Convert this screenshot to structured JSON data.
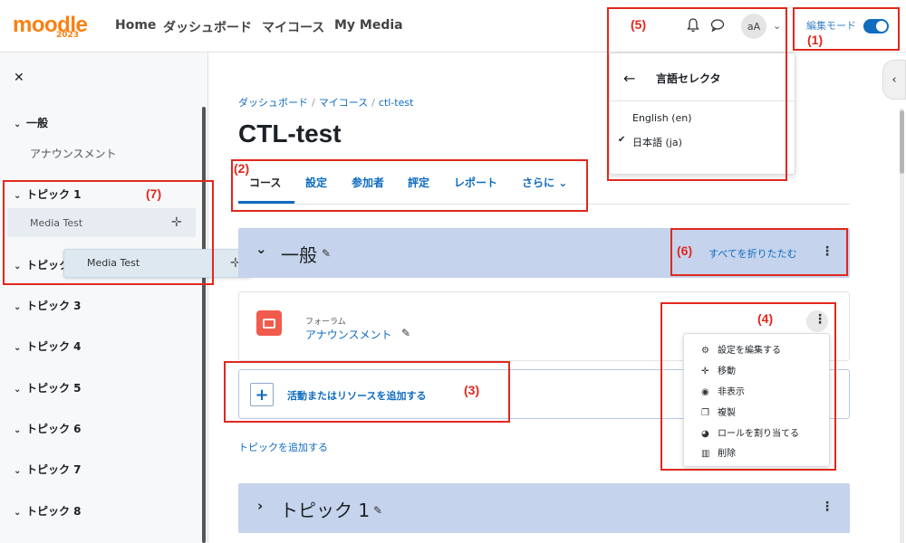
{
  "header": {
    "logo_text": "moodle",
    "logo_year": "2023",
    "nav": [
      "Home",
      "ダッシュボード",
      "マイコース",
      "My Media"
    ],
    "avatar_initials": "aA",
    "edit_mode_label": "編集モード",
    "edit_mode_on": true
  },
  "language_menu": {
    "title": "言語セレクタ",
    "options": [
      "English (en)",
      "日本語 (ja)"
    ],
    "selected": "日本語 (ja)"
  },
  "drawer": {
    "sections": [
      {
        "label": "一般",
        "items": [
          "アナウンスメント"
        ]
      },
      {
        "label": "トピック 1",
        "items": [
          "Media Test"
        ]
      },
      {
        "label": "トピック 2",
        "items": []
      },
      {
        "label": "トピック 3",
        "items": []
      },
      {
        "label": "トピック 4",
        "items": []
      },
      {
        "label": "トピック 5",
        "items": []
      },
      {
        "label": "トピック 6",
        "items": []
      },
      {
        "label": "トピック 7",
        "items": []
      },
      {
        "label": "トピック 8",
        "items": []
      }
    ],
    "dragging_item": "Media Test"
  },
  "breadcrumb": [
    "ダッシュボード",
    "マイコース",
    "ctl-test"
  ],
  "page_title": "CTL-test",
  "tabs": [
    "コース",
    "設定",
    "参加者",
    "評定",
    "レポート",
    "さらに"
  ],
  "active_tab": "コース",
  "sections": [
    {
      "title": "一般",
      "collapse_all": "すべてを折りたたむ"
    },
    {
      "title": "トピック 1"
    }
  ],
  "activity": {
    "type": "フォーラム",
    "name": "アナウンスメント"
  },
  "add_activity_label": "活動またはリソースを追加する",
  "add_topic_label": "トピックを追加する",
  "action_menu": [
    {
      "icon": "gear-icon",
      "label": "設定を編集する"
    },
    {
      "icon": "move-icon",
      "label": "移動"
    },
    {
      "icon": "eye-icon",
      "label": "非表示"
    },
    {
      "icon": "copy-icon",
      "label": "複製"
    },
    {
      "icon": "user-circle-icon",
      "label": "ロールを割り当てる"
    },
    {
      "icon": "trash-icon",
      "label": "削除"
    }
  ],
  "annotations": [
    "(1)",
    "(2)",
    "(3)",
    "(4)",
    "(5)",
    "(6)",
    "(7)"
  ],
  "colors": {
    "brand_orange": "#f98012",
    "link_blue": "#0f6cbf",
    "section_bg": "#c5d3ec",
    "annotation_red": "#e0281e",
    "forum_icon_bg": "#f15b4d"
  }
}
